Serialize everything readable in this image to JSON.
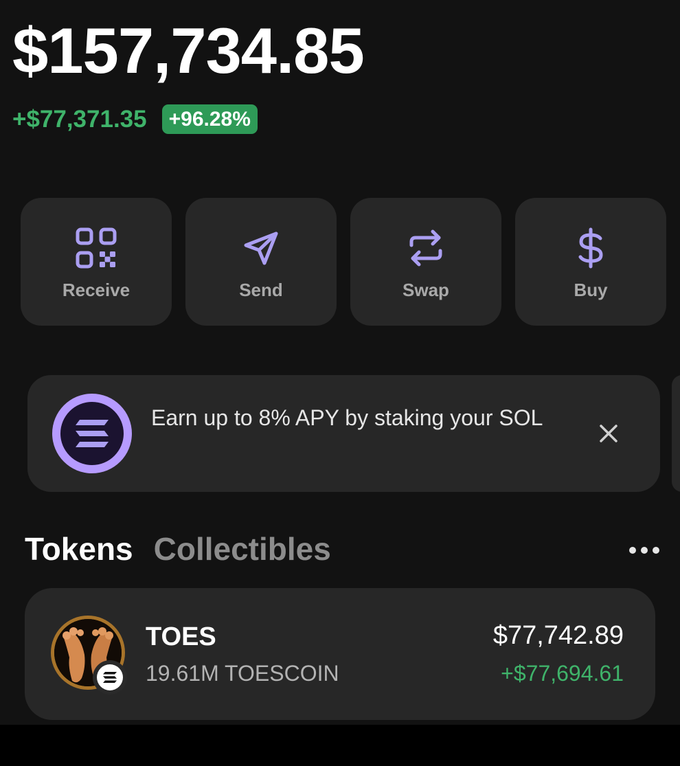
{
  "wallet": {
    "balance": "$157,734.85",
    "change_amount": "+$77,371.35",
    "change_percent": "+96.28%"
  },
  "actions": [
    {
      "label": "Receive",
      "icon": "qr-code-icon"
    },
    {
      "label": "Send",
      "icon": "send-icon"
    },
    {
      "label": "Swap",
      "icon": "swap-icon"
    },
    {
      "label": "Buy",
      "icon": "dollar-icon"
    }
  ],
  "banner": {
    "text": "Earn up to 8% APY by staking your SOL",
    "icon": "solana-logo-icon",
    "close_icon": "close-icon"
  },
  "tabs": [
    {
      "label": "Tokens",
      "active": true
    },
    {
      "label": "Collectibles",
      "active": false
    }
  ],
  "more_icon": "more-icon",
  "tokens": [
    {
      "name": "TOES",
      "amount": "19.61M TOESCOIN",
      "value": "$77,742.89",
      "change": "+$77,694.61",
      "chain_icon": "solana-badge-icon"
    }
  ],
  "colors": {
    "background": "#121212",
    "card": "#272727",
    "accent_purple": "#ab9ff2",
    "positive_green": "#3fb36a",
    "badge_green": "#2e9a57"
  }
}
